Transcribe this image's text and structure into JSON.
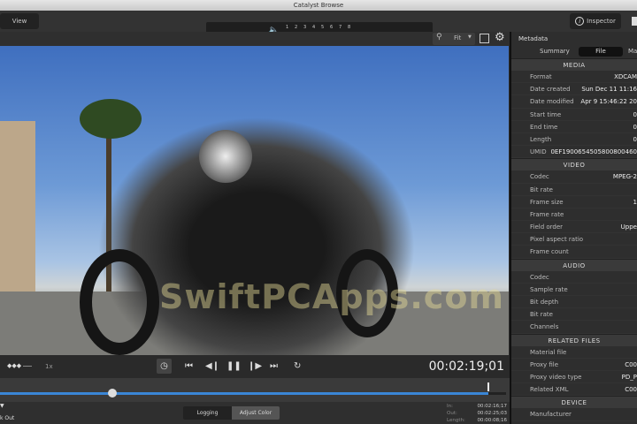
{
  "window": {
    "title": "Catalyst Browse"
  },
  "toolbar": {
    "view_label": "View",
    "inspector_label": "Inspector",
    "channels": [
      "1",
      "2",
      "3",
      "4",
      "5",
      "6",
      "7",
      "8"
    ],
    "meter_color": "#8be000"
  },
  "viewer": {
    "zoom": "Fit",
    "watermark": "SwiftPCApps.com"
  },
  "panel": {
    "title": "Metadata",
    "tabs": [
      "Summary",
      "File",
      "Ma"
    ],
    "active_tab": "File",
    "sections": [
      {
        "title": "MEDIA",
        "rows": [
          {
            "k": "Format",
            "v": "XDCAM"
          },
          {
            "k": "Date created",
            "v": "Sun Dec 11 11:16"
          },
          {
            "k": "Date modified",
            "v": "Apr  9 15:46:22 20"
          },
          {
            "k": "Start time",
            "v": "0"
          },
          {
            "k": "End time",
            "v": "0"
          },
          {
            "k": "Length",
            "v": "0"
          },
          {
            "k": "UMID",
            "v": "0EF1900654505800800460"
          }
        ]
      },
      {
        "title": "VIDEO",
        "rows": [
          {
            "k": "Codec",
            "v": "MPEG-2"
          },
          {
            "k": "Bit rate",
            "v": ""
          },
          {
            "k": "Frame size",
            "v": "1"
          },
          {
            "k": "Frame rate",
            "v": ""
          },
          {
            "k": "Field order",
            "v": "Uppe"
          },
          {
            "k": "Pixel aspect ratio",
            "v": ""
          },
          {
            "k": "Frame count",
            "v": ""
          }
        ]
      },
      {
        "title": "AUDIO",
        "rows": [
          {
            "k": "Codec",
            "v": ""
          },
          {
            "k": "Sample rate",
            "v": ""
          },
          {
            "k": "Bit depth",
            "v": ""
          },
          {
            "k": "Bit rate",
            "v": ""
          },
          {
            "k": "Channels",
            "v": ""
          }
        ]
      },
      {
        "title": "RELATED FILES",
        "rows": [
          {
            "k": "Material file",
            "v": ""
          },
          {
            "k": "Proxy file",
            "v": "C00"
          },
          {
            "k": "Proxy video type",
            "v": "PD_P"
          },
          {
            "k": "Related XML",
            "v": "C00"
          }
        ]
      },
      {
        "title": "DEVICE",
        "rows": [
          {
            "k": "Manufacturer",
            "v": ""
          }
        ]
      }
    ]
  },
  "transport": {
    "speed": "1x",
    "timecode": "00:02:19;01",
    "playhead_fraction": 0.22
  },
  "bottom": {
    "tabs": [
      "Logging",
      "Adjust Color"
    ],
    "active_tab": "Adjust Color",
    "mark_out": "k Out",
    "in_label": "In:",
    "in": "00:02:16;17",
    "out_label": "Out:",
    "out": "00:02:25;03",
    "length_label": "Length:",
    "length": "00:00:08;16"
  }
}
